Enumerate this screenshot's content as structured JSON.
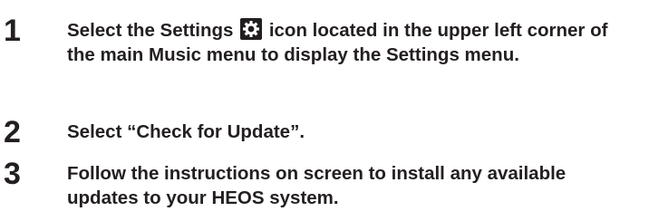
{
  "steps": [
    {
      "number": "1",
      "text_before_icon": "Select the Settings",
      "icon": "settings-gear-icon",
      "text_after_icon": "icon located in the upper left corner of the main Music menu to display the Settings menu."
    },
    {
      "number": "2",
      "text": "Select “Check for Update”."
    },
    {
      "number": "3",
      "text": "Follow the instructions on screen to install any available updates to your HEOS system."
    }
  ],
  "colors": {
    "text": "#231f20",
    "icon_background": "#231f20",
    "icon_foreground": "#ffffff"
  }
}
